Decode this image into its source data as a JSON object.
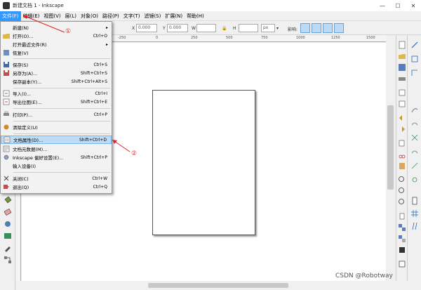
{
  "window": {
    "title": "新建文档 1 - Inkscape",
    "minimize": "—",
    "maximize": "☐",
    "close": "✕"
  },
  "menubar": [
    {
      "label": "文件(F)",
      "active": true
    },
    {
      "label": "编辑(E)"
    },
    {
      "label": "视图(V)"
    },
    {
      "label": "层(L)"
    },
    {
      "label": "对象(O)"
    },
    {
      "label": "路径(P)"
    },
    {
      "label": "文字(T)"
    },
    {
      "label": "滤镜(S)"
    },
    {
      "label": "扩展(N)"
    },
    {
      "label": "帮助(H)"
    }
  ],
  "toolbar": {
    "x_label": "X",
    "x_value": "0.000",
    "y_label": "Y",
    "y_value": "0.000",
    "w_label": "W",
    "w_value": "",
    "h_label": "H",
    "h_value": "",
    "unit": "px",
    "affect_label": "影响:"
  },
  "ruler": {
    "ticks": [
      "-250",
      "0",
      "250",
      "500",
      "750",
      "1000",
      "1250",
      "1500"
    ]
  },
  "file_menu": {
    "items": [
      {
        "label": "新建(N)",
        "shortcut": "",
        "submenu": true,
        "icon": "none"
      },
      {
        "label": "打开(O)...",
        "shortcut": "Ctrl+O",
        "icon": "open-folder-icon"
      },
      {
        "label": "打开最近文件(R)",
        "shortcut": "",
        "submenu": true,
        "icon": "none"
      },
      {
        "label": "恢复(V)",
        "shortcut": "",
        "icon": "revert-icon"
      },
      {
        "label": "保存(S)",
        "shortcut": "Ctrl+S",
        "icon": "save-icon"
      },
      {
        "label": "另存为(A)...",
        "shortcut": "Shift+Ctrl+S",
        "icon": "save-as-icon"
      },
      {
        "label": "保存副本(Y)...",
        "shortcut": "Shift+Ctrl+Alt+S",
        "icon": "none"
      },
      {
        "label": "导入(I)...",
        "shortcut": "Ctrl+I",
        "icon": "import-icon"
      },
      {
        "label": "导出位图(E)...",
        "shortcut": "Shift+Ctrl+E",
        "icon": "export-icon"
      },
      {
        "label": "打印(P)...",
        "shortcut": "Ctrl+P",
        "icon": "print-icon"
      },
      {
        "label": "清除定义(U)",
        "shortcut": "",
        "icon": "vacuum-icon"
      },
      {
        "label": "文档属性(D)...",
        "shortcut": "Shift+Ctrl+D",
        "icon": "document-properties-icon",
        "highlight": true
      },
      {
        "label": "文档元数据(M)...",
        "shortcut": "",
        "icon": "metadata-icon"
      },
      {
        "label": "Inkscape 偏好设置(E)...",
        "shortcut": "Shift+Ctrl+P",
        "icon": "preferences-icon"
      },
      {
        "label": "输入设备(I)",
        "shortcut": "",
        "icon": "none"
      },
      {
        "label": "关闭(C)",
        "shortcut": "Ctrl+W",
        "icon": "close-doc-icon"
      },
      {
        "label": "退出(Q)",
        "shortcut": "Ctrl+Q",
        "icon": "quit-icon"
      }
    ]
  },
  "annotations": {
    "marker1": "①",
    "marker2": "②",
    "color": "#d22222"
  },
  "watermark": "CSDN @Robotway"
}
